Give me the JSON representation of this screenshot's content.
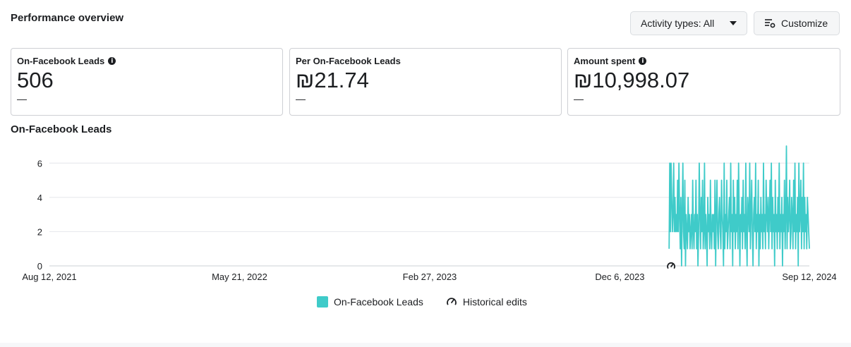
{
  "header": {
    "title": "Performance overview",
    "activity_button": "Activity types: All",
    "customize_button": "Customize"
  },
  "cards": [
    {
      "label": "On-Facebook Leads",
      "value": "506",
      "sub": "—",
      "info": true
    },
    {
      "label": "Per On-Facebook Leads",
      "value": "₪21.74",
      "sub": "—",
      "info": false
    },
    {
      "label": "Amount spent",
      "value": "₪10,998.07",
      "sub": "—",
      "info": true
    }
  ],
  "chart_section": {
    "title": "On-Facebook Leads"
  },
  "legend": {
    "leads": "On-Facebook Leads",
    "edits": "Historical edits"
  },
  "colors": {
    "series": "#3fcbc9",
    "grid": "#e4e6eb",
    "text": "#1c1e21"
  },
  "chart_data": {
    "type": "line",
    "title": "On-Facebook Leads",
    "x_tick_labels": [
      "Aug 12, 2021",
      "May 21, 2022",
      "Feb 27, 2023",
      "Dec 6, 2023",
      "Sep 12, 2024"
    ],
    "x_range": [
      "2021-08-12",
      "2024-09-12"
    ],
    "y_ticks": [
      0,
      2,
      4,
      6
    ],
    "ylim": [
      0,
      7
    ],
    "grid": true,
    "legend_position": "bottom",
    "historical_edit_dates": [
      "2024-02-20"
    ],
    "series": [
      {
        "name": "On-Facebook Leads",
        "color": "#3fcbc9",
        "start_date": "2024-02-17",
        "end_date": "2024-09-12",
        "values": [
          1,
          6,
          2,
          6,
          4,
          2,
          3,
          6,
          2,
          4,
          2,
          3,
          2,
          5,
          2,
          6,
          3,
          1,
          4,
          0,
          3,
          6,
          2,
          1,
          5,
          0,
          3,
          2,
          1,
          4,
          2,
          3,
          1,
          2,
          3,
          1,
          5,
          2,
          1,
          3,
          2,
          5,
          1,
          3,
          0,
          2,
          6,
          3,
          1,
          4,
          2,
          5,
          1,
          2,
          6,
          1,
          3,
          2,
          0,
          4,
          2,
          3,
          1,
          5,
          2,
          1,
          3,
          2,
          3,
          1,
          5,
          0,
          3,
          5,
          2,
          1,
          3,
          4,
          2,
          1,
          5,
          3,
          2,
          0,
          6,
          1,
          3,
          2,
          5,
          1,
          2,
          3,
          4,
          1,
          6,
          2,
          3,
          0,
          5,
          2,
          4,
          1,
          3,
          2,
          5,
          1,
          6,
          3,
          0,
          3,
          2,
          4,
          1,
          5,
          2,
          3,
          1,
          6,
          2,
          0,
          4,
          3,
          2,
          6,
          1,
          3,
          5,
          2,
          0,
          3,
          4,
          2,
          6,
          1,
          3,
          2,
          5,
          0,
          3,
          1,
          4,
          2,
          3,
          1,
          6,
          2,
          3,
          1,
          5,
          3,
          2,
          4,
          1,
          3,
          5,
          2,
          6,
          1,
          4,
          2,
          3,
          0,
          5,
          2,
          3,
          1,
          4,
          2,
          6,
          1,
          3,
          2,
          4,
          0,
          3,
          2,
          5,
          1,
          3,
          7,
          1,
          4,
          2,
          3,
          5,
          1,
          2,
          4,
          3,
          1,
          5,
          2,
          6,
          1,
          3,
          2,
          4,
          0,
          6,
          2,
          3,
          5,
          1,
          4,
          2,
          6,
          1,
          4,
          2,
          3,
          1,
          4,
          3,
          2,
          1
        ]
      }
    ]
  }
}
